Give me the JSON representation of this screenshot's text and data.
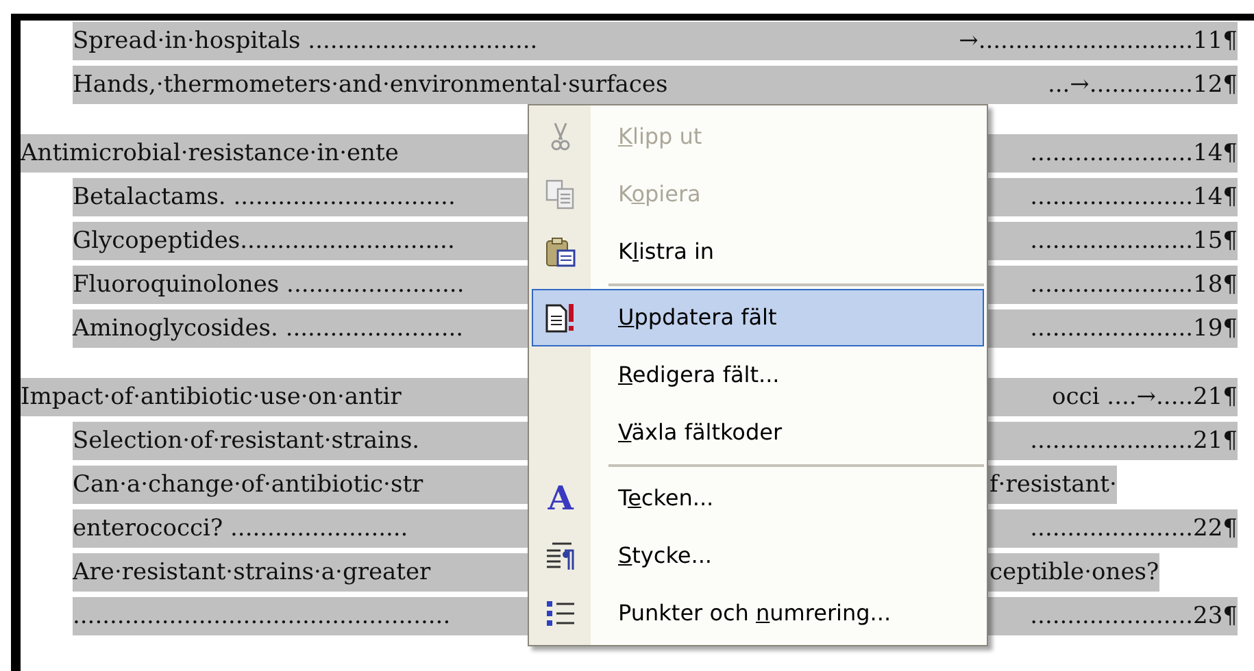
{
  "document": {
    "sections": [
      {
        "lines": [
          {
            "kind": "leader",
            "indented": true,
            "left": "Spread·in·hospitals ...............................",
            "right": "→.............................11¶"
          },
          {
            "kind": "leader",
            "indented": true,
            "left": "Hands,·thermometers·and·environmental·surfaces",
            "right": "...→..............12¶"
          }
        ]
      },
      {
        "lines": [
          {
            "kind": "leader",
            "indented": false,
            "left": "Antimicrobial·resistance·in·ente",
            "right": "......................14¶"
          },
          {
            "kind": "leader",
            "indented": true,
            "left": "Betalactams. ..............................",
            "right": "......................14¶"
          },
          {
            "kind": "leader",
            "indented": true,
            "left": "Glycopeptides.............................",
            "right": "......................15¶"
          },
          {
            "kind": "leader",
            "indented": true,
            "left": "Fluoroquinolones ........................",
            "right": "......................18¶"
          },
          {
            "kind": "leader",
            "indented": true,
            "left": "Aminoglycosides. ........................",
            "right": "......................19¶"
          }
        ]
      },
      {
        "lines": [
          {
            "kind": "leader",
            "indented": false,
            "left": "Impact·of·antibiotic·use·on·antir",
            "right": "occi ....→.....21¶"
          },
          {
            "kind": "leader",
            "indented": true,
            "left": "Selection·of·resistant·strains.",
            "right": "......................21¶"
          },
          {
            "kind": "wrapped",
            "indented": true,
            "left": "Can·a·change·of·antibiotic·str",
            "right": "f·resistant·"
          },
          {
            "kind": "leader",
            "indented": true,
            "left": "enterococci? ........................",
            "right": "......................22¶"
          },
          {
            "kind": "wrapped",
            "indented": true,
            "left": "Are·resistant·strains·a·greater",
            "right": "ceptible·ones?"
          },
          {
            "kind": "leader",
            "indented": true,
            "left": "...................................................",
            "right": "......................23¶"
          }
        ]
      }
    ]
  },
  "context_menu": {
    "items": [
      {
        "kind": "command",
        "key": "K",
        "after": "lipp ut",
        "disabled": true,
        "selected": false
      },
      {
        "kind": "command",
        "before": "K",
        "key": "o",
        "after": "piera",
        "disabled": true,
        "selected": false
      },
      {
        "kind": "command",
        "before": "K",
        "key": "l",
        "after": "istra in",
        "disabled": false,
        "selected": false
      },
      {
        "kind": "separator"
      },
      {
        "kind": "command",
        "key": "U",
        "after": "ppdatera fält",
        "disabled": false,
        "selected": true
      },
      {
        "kind": "command",
        "key": "R",
        "after": "edigera fält...",
        "disabled": false,
        "selected": false
      },
      {
        "kind": "command",
        "key": "V",
        "after": "äxla fältkoder",
        "disabled": false,
        "selected": false
      },
      {
        "kind": "separator"
      },
      {
        "kind": "command",
        "before": "T",
        "key": "e",
        "after": "cken...",
        "disabled": false,
        "selected": false,
        "icon_text": "A"
      },
      {
        "kind": "command",
        "key": "S",
        "after": "tycke...",
        "disabled": false,
        "selected": false
      },
      {
        "kind": "command",
        "before": "Punkter och ",
        "key": "n",
        "after": "umrering...",
        "disabled": false,
        "selected": false
      }
    ]
  }
}
